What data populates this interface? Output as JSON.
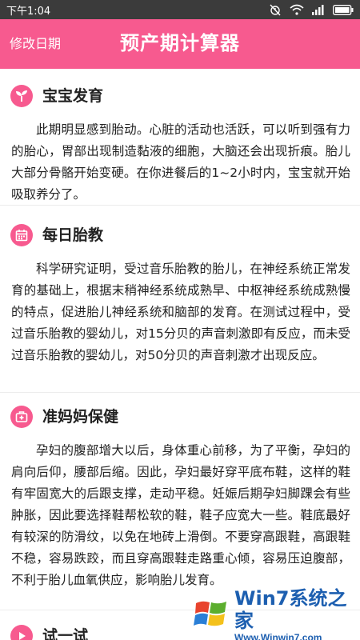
{
  "status_bar": {
    "time": "下午1:04",
    "icons": [
      "alarm-off-icon",
      "wifi-icon",
      "signal-icon",
      "battery-icon"
    ]
  },
  "app_bar": {
    "edit_date_label": "修改日期",
    "title": "预产期计算器",
    "color": "#f75a8f"
  },
  "sections": [
    {
      "icon": "sprout-icon",
      "title": "宝宝发育",
      "body": "此期明显感到胎动。心脏的活动也活跃，可以听到强有力的胎心，胃部出现制造黏液的细胞，大脑还会出现折痕。胎儿大部分骨骼开始变硬。在你进餐后的1~2小时内，宝宝就开始吸取养分了。"
    },
    {
      "icon": "calendar-icon",
      "title": "每日胎教",
      "body": "科学研究证明，受过音乐胎教的胎儿，在神经系统正常发育的基础上，根据末稍神经系统成熟早、中枢神经系统成熟慢的特点，促进胎儿神经系统和脑部的发育。在测试过程中，受过音乐胎教的婴幼儿，对15分贝的声音刺激即有反应，而未受过音乐胎教的婴幼儿，对50分贝的声音刺激才出现反应。"
    },
    {
      "icon": "medical-kit-icon",
      "title": "准妈妈保健",
      "body": "孕妇的腹部增大以后，身体重心前移，为了平衡，孕妇的肩向后仰，腰部后缩。因此，孕妇最好穿平底布鞋，这样的鞋有牢固宽大的后跟支撑，走动平稳。妊娠后期孕妇脚踝会有些肿胀，因此要选择鞋帮松软的鞋，鞋子应宽大一些。鞋底最好有较深的防滑纹，以免在地砖上滑倒。不要穿高跟鞋，高跟鞋不稳，容易跌跤，而且穿高跟鞋走路重心倾，容易压迫腹部，不利于胎儿血氧供应，影响胎儿发育。"
    },
    {
      "icon": "play-icon",
      "title": "试一试",
      "body": ""
    }
  ],
  "watermark": {
    "title": "Win7系统之家",
    "url": "Www.Winwin7.com"
  }
}
